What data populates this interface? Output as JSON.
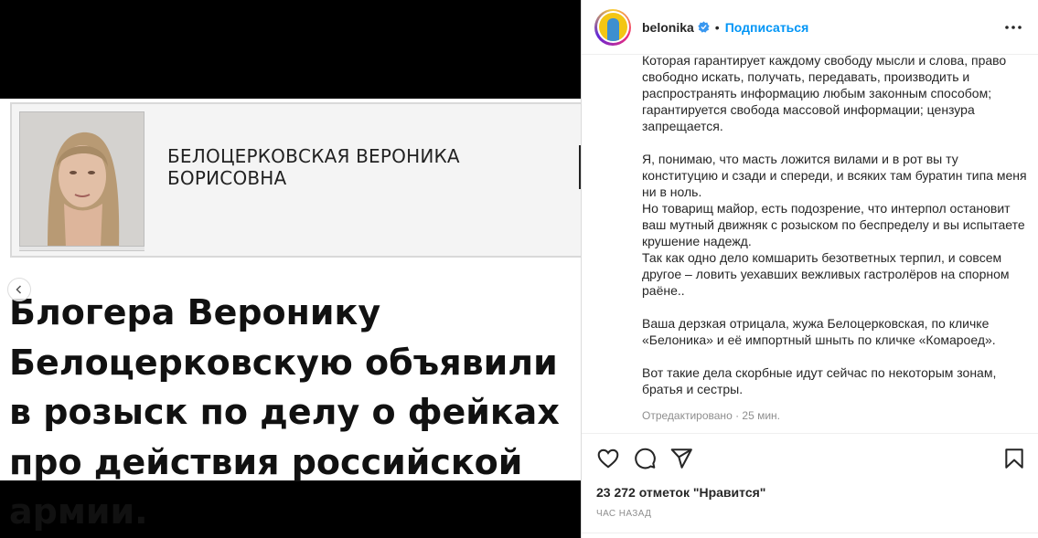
{
  "media": {
    "id_name": "БЕЛОЦЕРКОВСКАЯ ВЕРОНИКА БОРИСОВНА",
    "headline": "Блогера Веронику Белоцерковскую объявили в розыск по делу о фейках про действия российской армии."
  },
  "header": {
    "username": "belonika",
    "follow_label": "Подписаться",
    "dot": "•"
  },
  "caption": {
    "paragraphs": [
      "Которая гарантирует каждому свободу мысли и слова, право свободно искать, получать, передавать, производить и распространять информацию любым законным способом; гарантируется свобода массовой информации; цензура запрещается.",
      "Я, понимаю, что масть ложится вилами и в рот вы ту конституцию и сзади и спереди, и всяких там буратин типа меня ни в ноль.\nНо товарищ майор, есть подозрение, что интерпол остановит ваш мутный движняк с розыском по беспределу и вы испытаете крушение надежд.\nТак как одно дело комшарить безответных терпил, и совсем другое – ловить уехавших вежливых гастролёров на спорном раёне..",
      "Ваша дерзкая отрицала, жужа Белоцерковская, по кличке «Белоника» и её импортный шныть по кличке «Комароед».",
      "Вот такие дела скорбные идут сейчас по некоторым зонам, братья и сестры."
    ],
    "edited": "Отредактировано · 25 мин."
  },
  "footer": {
    "likes": "23 272 отметок \"Нравится\"",
    "time": "ЧАС НАЗАД"
  },
  "colors": {
    "accent": "#0095f6",
    "verified": "#3897f0",
    "muted": "#8e8e8e"
  }
}
